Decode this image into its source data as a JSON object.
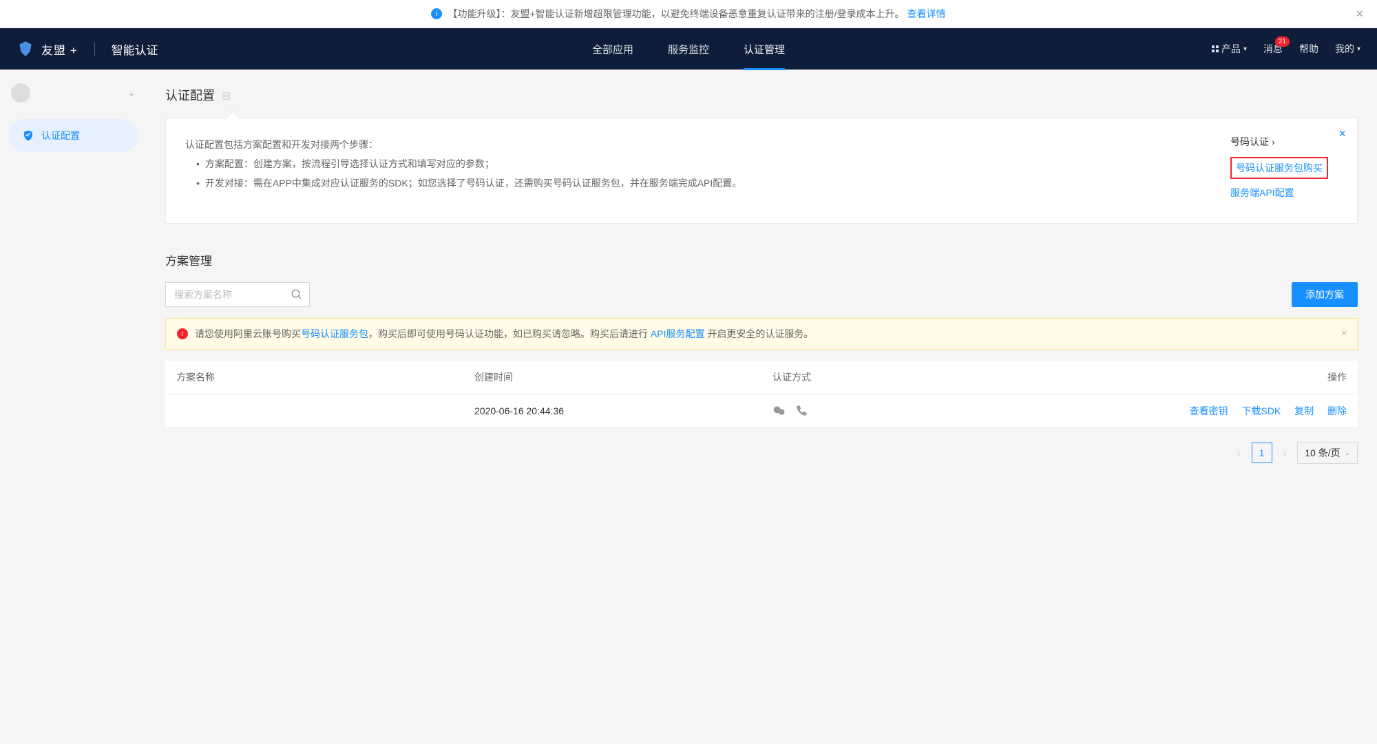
{
  "announcement": {
    "text": "【功能升级】：友盟+智能认证新增超限管理功能，以避免终端设备恶意重复认证带来的注册/登录成本上升。",
    "link_text": "查看详情"
  },
  "nav": {
    "brand": "友盟 +",
    "subtitle": "智能认证",
    "tabs": [
      {
        "label": "全部应用"
      },
      {
        "label": "服务监控"
      },
      {
        "label": "认证管理"
      }
    ],
    "right": {
      "product": "产品",
      "message": "消息",
      "message_badge": "21",
      "help": "帮助",
      "mine": "我的"
    }
  },
  "sidebar": {
    "item1": "认证配置"
  },
  "page": {
    "title": "认证配置"
  },
  "info_box": {
    "intro": "认证配置包括方案配置和开发对接两个步骤：",
    "step1": "方案配置：创建方案，按流程引导选择认证方式和填写对应的参数；",
    "step2": "开发对接：需在APP中集成对应认证服务的SDK；如您选择了号码认证，还需购买号码认证服务包，并在服务端完成API配置。",
    "right_title": "号码认证",
    "right_link1": "号码认证服务包购买",
    "right_link2": "服务端API配置"
  },
  "section": {
    "title": "方案管理",
    "search_placeholder": "搜索方案名称",
    "add_btn": "添加方案"
  },
  "alert": {
    "prefix": "请您使用阿里云账号购买",
    "link1": "号码认证服务包",
    "mid": "，购买后即可使用号码认证功能，如已购买请忽略。购买后请进行 ",
    "link2": "API服务配置",
    "suffix": " 开启更安全的认证服务。"
  },
  "table": {
    "headers": {
      "name": "方案名称",
      "created": "创建时间",
      "auth": "认证方式",
      "action": "操作"
    },
    "rows": [
      {
        "name": "",
        "created": "2020-06-16 20:44:36",
        "actions": {
          "key": "查看密钥",
          "sdk": "下载SDK",
          "copy": "复制",
          "del": "删除"
        }
      }
    ]
  },
  "pagination": {
    "current": "1",
    "page_size": "10 条/页"
  }
}
